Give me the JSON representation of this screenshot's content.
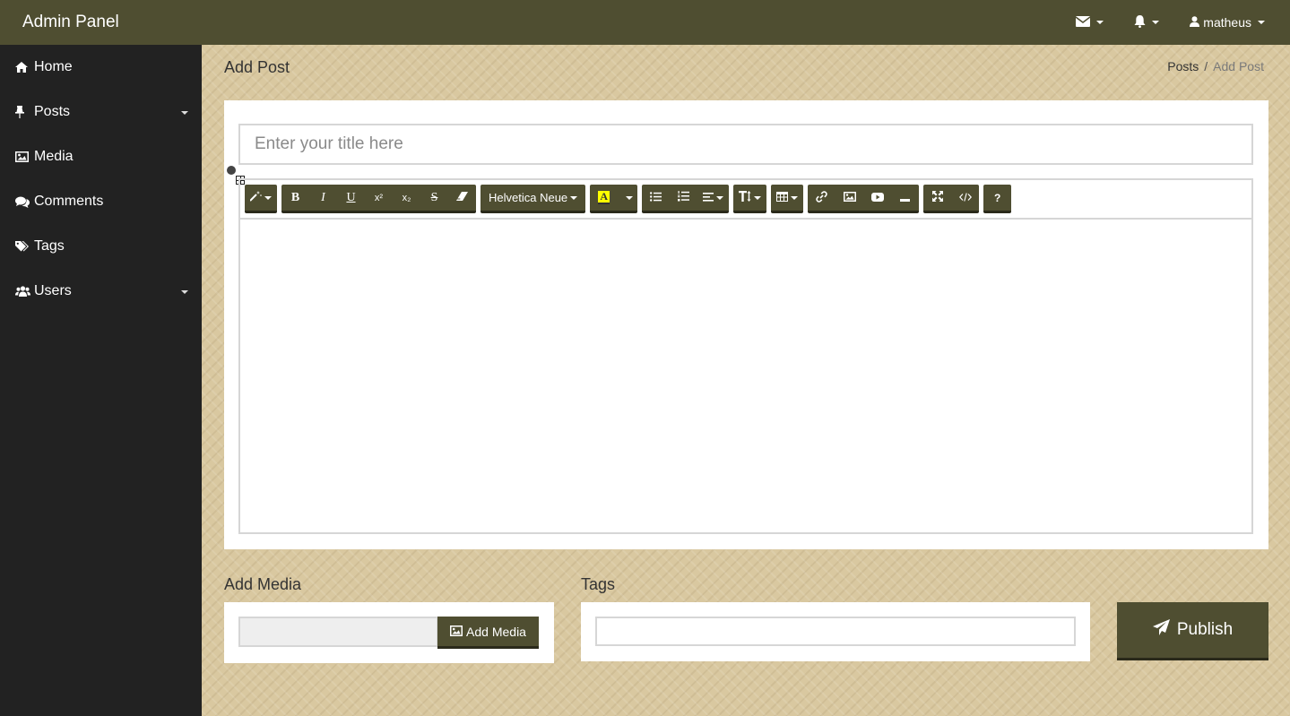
{
  "app": {
    "title": "Admin Panel"
  },
  "topbar": {
    "mail_icon": "envelope-icon",
    "bell_icon": "bell-icon",
    "user_icon": "user-icon",
    "username": "matheus"
  },
  "sidebar": {
    "items": [
      {
        "label": "Home",
        "icon": "home-icon"
      },
      {
        "label": "Posts",
        "icon": "pin-icon",
        "has_submenu": true
      },
      {
        "label": "Media",
        "icon": "image-icon"
      },
      {
        "label": "Comments",
        "icon": "comments-icon"
      },
      {
        "label": "Tags",
        "icon": "tags-icon"
      },
      {
        "label": "Users",
        "icon": "users-icon",
        "has_submenu": true
      }
    ]
  },
  "page": {
    "title": "Add Post"
  },
  "breadcrumb": {
    "parent": "Posts",
    "separator": "/",
    "current": "Add Post"
  },
  "editor": {
    "title_placeholder": "Enter your title here",
    "font_name": "Helvetica Neue",
    "toolbar": {
      "bold": "B",
      "italic": "I",
      "underline": "U",
      "superscript": "x²",
      "subscript": "x₂",
      "strikethrough": "S",
      "help": "?"
    }
  },
  "media": {
    "section_label": "Add Media",
    "button_label": "Add Media"
  },
  "tags": {
    "section_label": "Tags"
  },
  "publish": {
    "label": "Publish"
  },
  "colors": {
    "accent": "#4f4e31",
    "sidebar": "#222222",
    "background": "#d9c8a0",
    "highlight": "#ffff00"
  }
}
